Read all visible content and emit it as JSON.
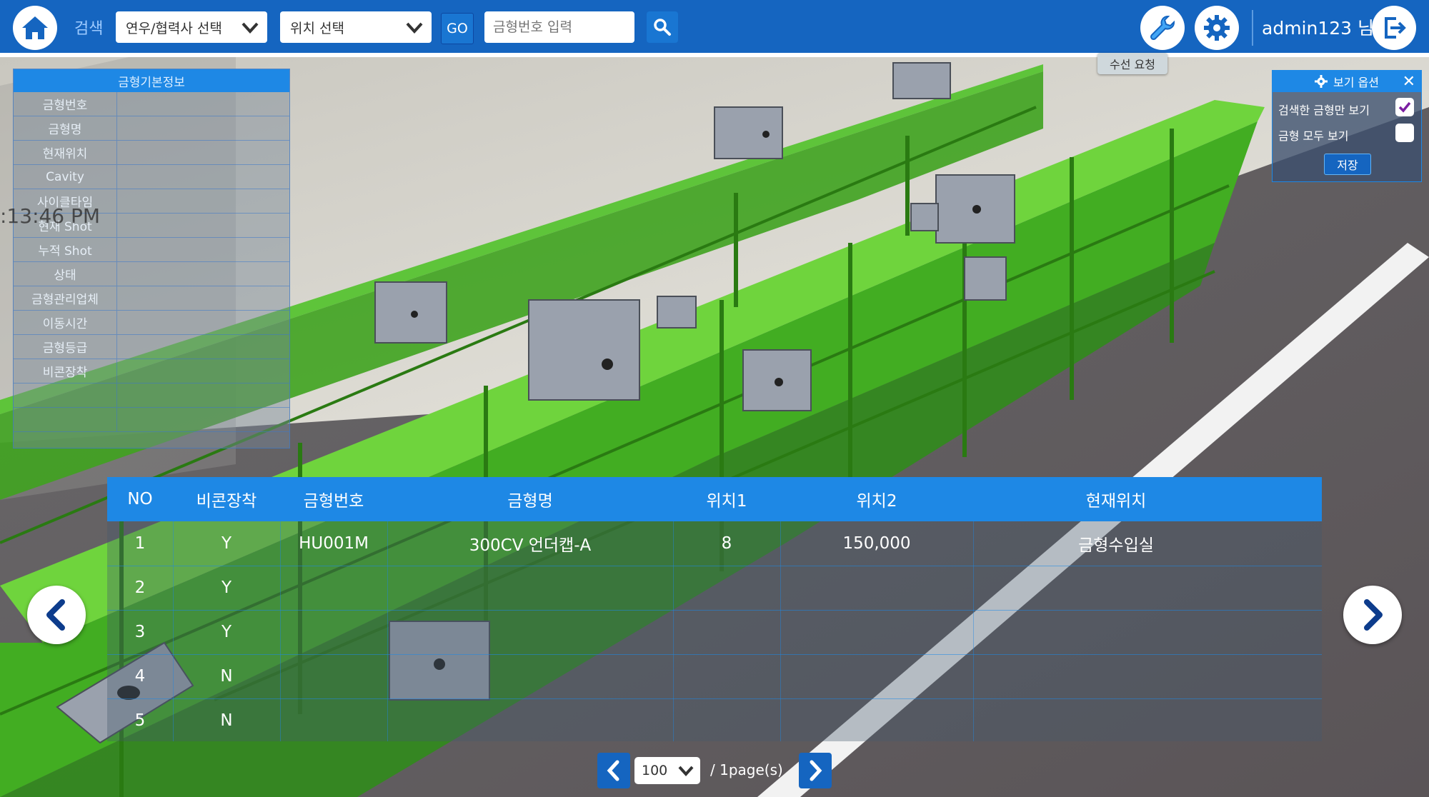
{
  "topbar": {
    "search_label": "검색",
    "company_select": "연우/협력사 선택",
    "location_select": "위치 선택",
    "go_label": "GO",
    "mold_no_placeholder": "금형번호 입력",
    "user": "admin123 님",
    "repair_tooltip": "수선 요청"
  },
  "info_panel": {
    "title": "금형기본정보",
    "fields": [
      "금형번호",
      "금형명",
      "현재위치",
      "Cavity",
      "사이클타임",
      "현재 Shot",
      "누적 Shot",
      "상태",
      "금형관리업체",
      "이동시간",
      "금형등급",
      "비콘장착"
    ]
  },
  "scene_text": {
    "clock": ":13:46 PM"
  },
  "options_panel": {
    "title": "보기 옵션",
    "option1": "검색한 금형만 보기",
    "option1_checked": true,
    "option2": "금형 모두 보기",
    "option2_checked": false,
    "save_label": "저장"
  },
  "table": {
    "headers": [
      "NO",
      "비콘장착",
      "금형번호",
      "금형명",
      "위치1",
      "위치2",
      "현재위치"
    ],
    "rows": [
      [
        "1",
        "Y",
        "HU001M",
        "300CV 언더캡-A",
        "8",
        "150,000",
        "금형수입실"
      ],
      [
        "2",
        "Y",
        "",
        "",
        "",
        "",
        ""
      ],
      [
        "3",
        "Y",
        "",
        "",
        "",
        "",
        ""
      ],
      [
        "4",
        "N",
        "",
        "",
        "",
        "",
        ""
      ],
      [
        "5",
        "N",
        "",
        "",
        "",
        "",
        ""
      ]
    ]
  },
  "pager": {
    "page_size": "100",
    "page_info": "/ 1page(s)"
  },
  "colors": {
    "topbar": "#1565c0",
    "accent": "#1e88e5",
    "shelf_green": "#4caf22",
    "check_purple": "#7b1fa2"
  }
}
